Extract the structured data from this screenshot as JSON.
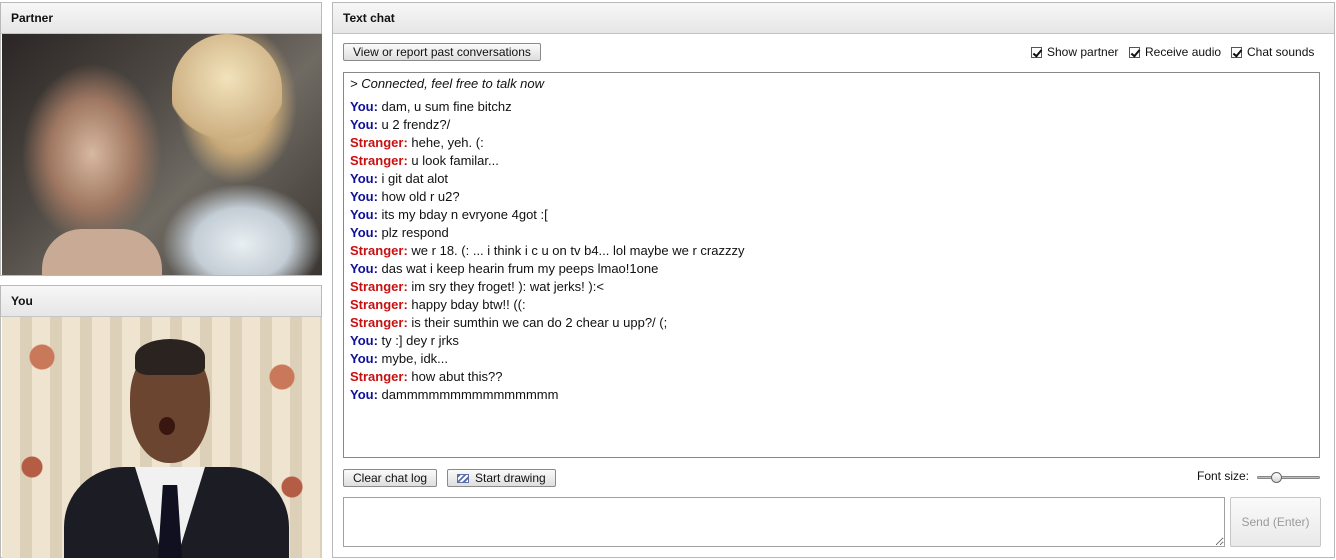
{
  "partner_panel": {
    "title": "Partner"
  },
  "you_panel": {
    "title": "You"
  },
  "chat_panel": {
    "title": "Text chat",
    "view_report_label": "View or report past conversations",
    "options": [
      {
        "label": "Show partner",
        "checked": true
      },
      {
        "label": "Receive audio",
        "checked": true
      },
      {
        "label": "Chat sounds",
        "checked": true
      }
    ],
    "status": "> Connected, feel free to talk now",
    "messages": [
      {
        "speaker": "You:",
        "type": "you",
        "text": "dam, u sum fine bitchz"
      },
      {
        "speaker": "You:",
        "type": "you",
        "text": "u 2 frendz?/"
      },
      {
        "speaker": "Stranger:",
        "type": "stranger",
        "text": "hehe, yeh. (:"
      },
      {
        "speaker": "Stranger:",
        "type": "stranger",
        "text": "u look familar..."
      },
      {
        "speaker": "You:",
        "type": "you",
        "text": "i git dat alot"
      },
      {
        "speaker": "You:",
        "type": "you",
        "text": "how old r u2?"
      },
      {
        "speaker": "You:",
        "type": "you",
        "text": "its my bday n evryone 4got :["
      },
      {
        "speaker": "You:",
        "type": "you",
        "text": "plz respond"
      },
      {
        "speaker": "Stranger:",
        "type": "stranger",
        "text": "we r 18. (: ... i think i c u on tv b4... lol maybe we r crazzzy"
      },
      {
        "speaker": "You:",
        "type": "you",
        "text": "das wat i keep hearin frum my peeps lmao!1one"
      },
      {
        "speaker": "Stranger:",
        "type": "stranger",
        "text": "im sry they froget! ): wat jerks! ):<"
      },
      {
        "speaker": "Stranger:",
        "type": "stranger",
        "text": "happy bday btw!! ((:"
      },
      {
        "speaker": "Stranger:",
        "type": "stranger",
        "text": "is their sumthin we can do 2 chear u upp?/ (;"
      },
      {
        "speaker": "You:",
        "type": "you",
        "text": "ty :] dey r jrks"
      },
      {
        "speaker": "You:",
        "type": "you",
        "text": "mybe, idk..."
      },
      {
        "speaker": "Stranger:",
        "type": "stranger",
        "text": "how abut this??"
      },
      {
        "speaker": "You:",
        "type": "you",
        "text": "dammmmmmmmmmmmmmm"
      }
    ],
    "clear_log_label": "Clear chat log",
    "start_drawing_label": "Start drawing",
    "font_size_label": "Font size:",
    "font_size_level": 0.25,
    "message_input_value": "",
    "send_label": "Send (Enter)"
  },
  "colors": {
    "you": "#0f0f9c",
    "stranger": "#c81010"
  },
  "icons": {
    "drawing": "pen-icon",
    "checkbox": "check-icon"
  }
}
